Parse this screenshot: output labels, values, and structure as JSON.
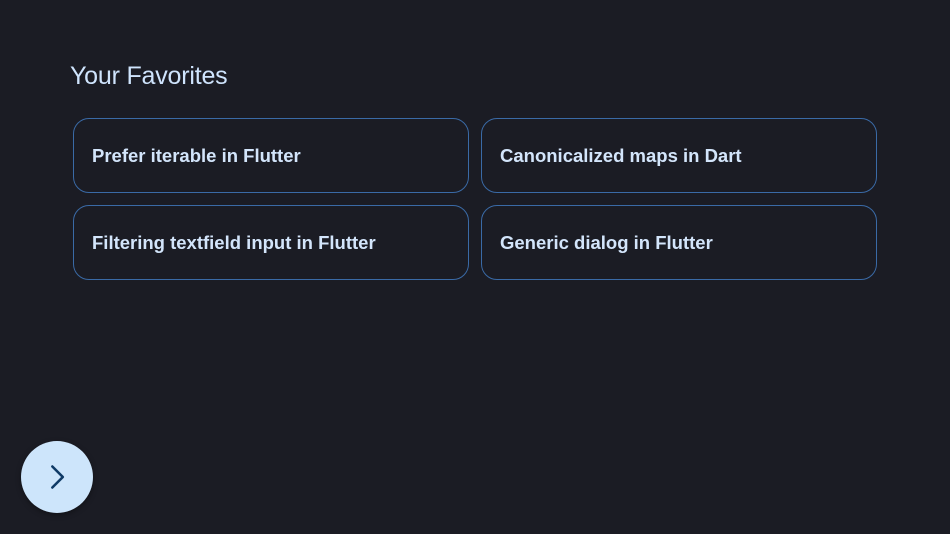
{
  "header": {
    "title": "Your Favorites"
  },
  "favorites": [
    {
      "label": "Prefer iterable in Flutter"
    },
    {
      "label": "Canonicalized maps in Dart"
    },
    {
      "label": "Filtering textfield input in Flutter"
    },
    {
      "label": "Generic dialog in Flutter"
    }
  ],
  "fab": {
    "icon": "chevron-right-icon"
  },
  "colors": {
    "background": "#1b1c24",
    "title": "#cfe4fd",
    "card_border": "#3a6aa6",
    "card_text": "#d3e5fb",
    "fab_background": "#cde5fb",
    "fab_icon": "#0f3a66"
  }
}
